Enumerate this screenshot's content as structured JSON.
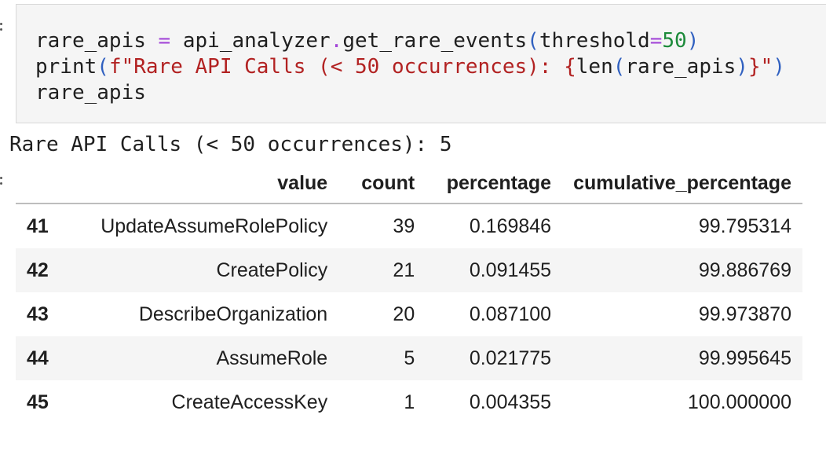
{
  "code_cell": {
    "lines": [
      [
        {
          "t": "rare_apis ",
          "c": "var"
        },
        {
          "t": "=",
          "c": "op"
        },
        {
          "t": " api_analyzer",
          "c": "var"
        },
        {
          "t": ".",
          "c": "op"
        },
        {
          "t": "get_rare_events",
          "c": "fn"
        },
        {
          "t": "(",
          "c": "paren"
        },
        {
          "t": "threshold",
          "c": "var"
        },
        {
          "t": "=",
          "c": "op"
        },
        {
          "t": "50",
          "c": "num"
        },
        {
          "t": ")",
          "c": "paren"
        }
      ],
      [
        {
          "t": "print",
          "c": "fn"
        },
        {
          "t": "(",
          "c": "paren"
        },
        {
          "t": "f\"Rare API Calls (< 50 occurrences): ",
          "c": "str"
        },
        {
          "t": "{",
          "c": "brace"
        },
        {
          "t": "len",
          "c": "fn"
        },
        {
          "t": "(",
          "c": "paren"
        },
        {
          "t": "rare_apis",
          "c": "var"
        },
        {
          "t": ")",
          "c": "paren"
        },
        {
          "t": "}",
          "c": "brace"
        },
        {
          "t": "\"",
          "c": "str"
        },
        {
          "t": ")",
          "c": "paren"
        }
      ],
      [
        {
          "t": "rare_apis",
          "c": "var"
        }
      ]
    ]
  },
  "output": {
    "stdout": "Rare API Calls (< 50 occurrences): 5",
    "dataframe": {
      "columns": [
        "",
        "value",
        "count",
        "percentage",
        "cumulative_percentage"
      ],
      "rows": [
        [
          "41",
          "UpdateAssumeRolePolicy",
          "39",
          "0.169846",
          "99.795314"
        ],
        [
          "42",
          "CreatePolicy",
          "21",
          "0.091455",
          "99.886769"
        ],
        [
          "43",
          "DescribeOrganization",
          "20",
          "0.087100",
          "99.973870"
        ],
        [
          "44",
          "AssumeRole",
          "5",
          "0.021775",
          "99.995645"
        ],
        [
          "45",
          "CreateAccessKey",
          "1",
          "0.004355",
          "100.000000"
        ]
      ]
    }
  },
  "colors": {
    "code_background": "#f5f5f5",
    "operator": "#a346d8",
    "parenthesis": "#3060c0",
    "number": "#1c8a3a",
    "string": "#b22222"
  }
}
